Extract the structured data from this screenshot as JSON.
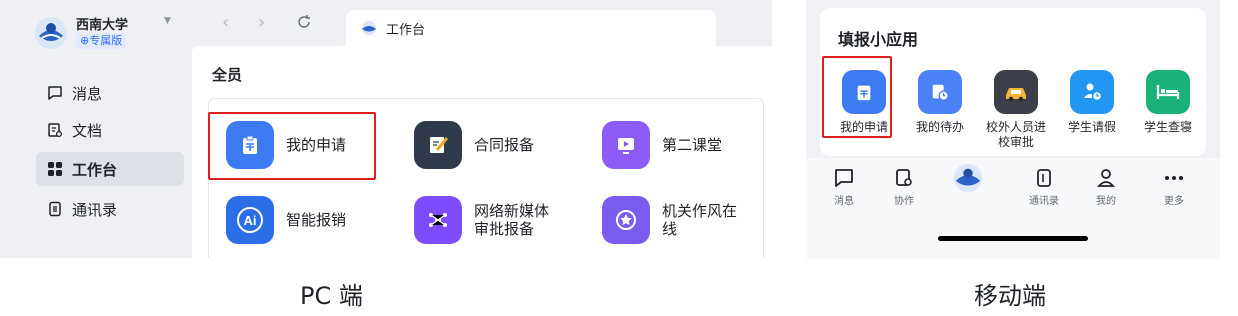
{
  "pc": {
    "org_name": "西南大学",
    "org_badge": "⊕专属版",
    "nav": [
      {
        "label": "消息",
        "icon": "message-icon"
      },
      {
        "label": "文档",
        "icon": "doc-icon"
      },
      {
        "label": "工作台",
        "icon": "grid-icon",
        "active": true
      },
      {
        "label": "通讯录",
        "icon": "contacts-icon"
      }
    ],
    "tab_label": "工作台",
    "section_title": "全员",
    "apps": [
      {
        "label": "我的申请",
        "icon": "clipboard-icon",
        "color": "#3d7bf2"
      },
      {
        "label": "合同报备",
        "icon": "pen-icon",
        "color": "#2f3a4a"
      },
      {
        "label": "第二课堂",
        "icon": "screen-play-icon",
        "color": "#8b5cf6"
      },
      {
        "label": "智能报销",
        "icon": "ai-icon",
        "color": "#2b6ee8"
      },
      {
        "label": "网络新媒体审批报备",
        "label_lines": [
          "网络新媒体",
          "审批报备"
        ],
        "icon": "network-icon",
        "color": "#7c4dff"
      },
      {
        "label": "机关作风在线",
        "label_lines": [
          "机关作风在",
          "线"
        ],
        "icon": "star-badge-icon",
        "color": "#7b5cf0"
      }
    ]
  },
  "mobile": {
    "card_title": "填报小应用",
    "apps": [
      {
        "label": "我的申请",
        "icon": "clipboard-icon",
        "color": "#3d7bf2"
      },
      {
        "label": "我的待办",
        "icon": "todo-clock-icon",
        "color": "#4b82f5"
      },
      {
        "label": "校外人员进校审批",
        "label_lines": [
          "校外人员进",
          "校审批"
        ],
        "icon": "car-icon",
        "color": "#3a3f4a"
      },
      {
        "label": "学生请假",
        "icon": "person-clock-icon",
        "color": "#2196f3"
      },
      {
        "label": "学生查寝",
        "icon": "bed-icon",
        "color": "#19b37a"
      }
    ],
    "tabs": [
      {
        "label": "消息",
        "icon": "message-icon"
      },
      {
        "label": "协作",
        "icon": "collab-icon"
      },
      {
        "label": "",
        "icon": "logo-icon"
      },
      {
        "label": "通讯录",
        "icon": "contacts-icon"
      },
      {
        "label": "我的",
        "icon": "person-icon"
      },
      {
        "label": "更多",
        "icon": "more-icon"
      }
    ]
  },
  "captions": {
    "pc": "PC 端",
    "mobile": "移动端"
  }
}
